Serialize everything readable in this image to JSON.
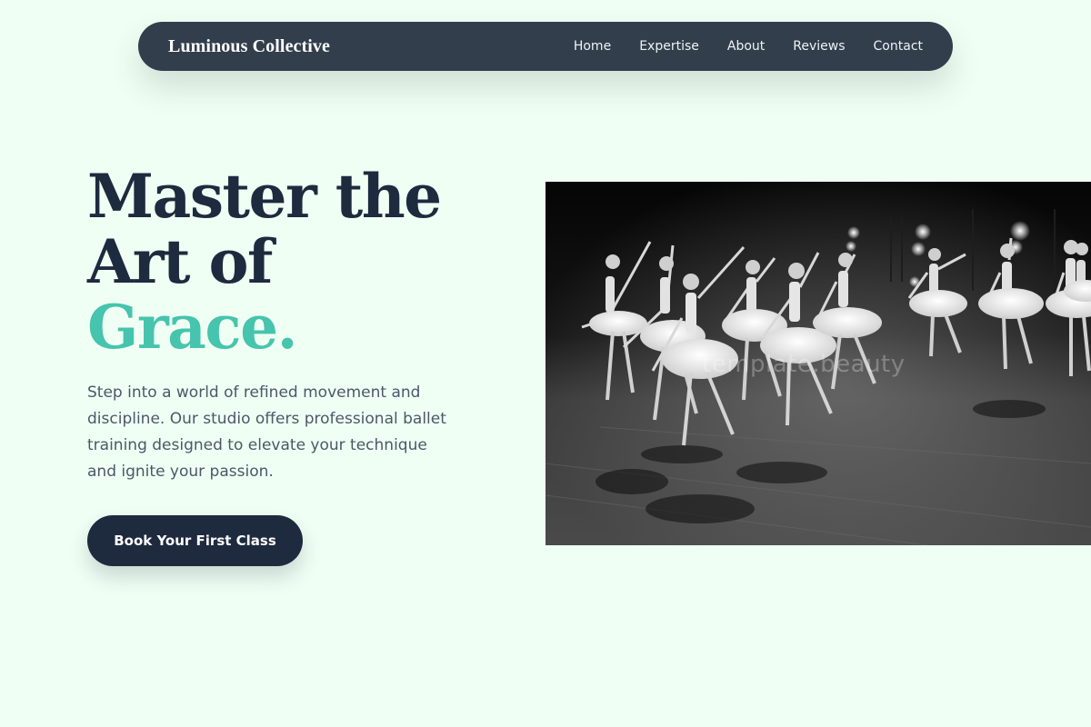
{
  "nav": {
    "brand": "Luminous Collective",
    "links": [
      "Home",
      "Expertise",
      "About",
      "Reviews",
      "Contact"
    ]
  },
  "hero": {
    "headline_line1": "Master the",
    "headline_line2": "Art of",
    "headline_accent": "Grace.",
    "description": "Step into a world of refined movement and discipline. Our studio offers professional ballet training designed to elevate your technique and ignite your passion.",
    "cta_label": "Book Your First Class",
    "image_alt": "Ballet dancers in white tutus performing on stage",
    "watermark": "template.beauty"
  },
  "colors": {
    "background": "#f0fff4",
    "nav": "#323e4c",
    "heading": "#1e2a3e",
    "accent": "#46c4ad",
    "body_text": "#4b5867"
  }
}
